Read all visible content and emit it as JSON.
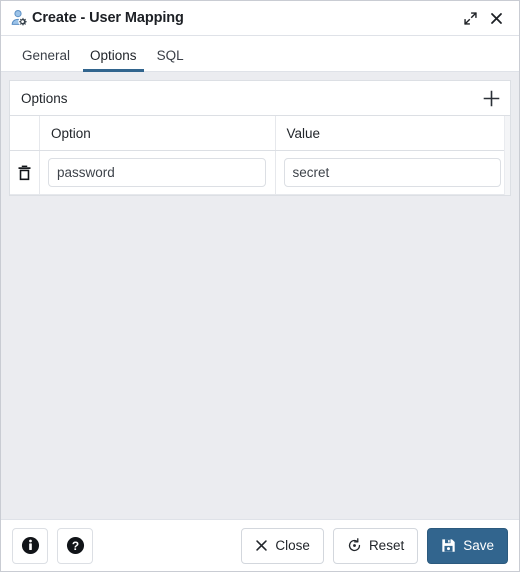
{
  "window": {
    "title": "Create - User Mapping",
    "icon": "user-mapping-icon",
    "maximize_icon": "expand-icon",
    "close_icon": "close-icon"
  },
  "tabs": [
    {
      "label": "General",
      "name": "tab-general",
      "active": false
    },
    {
      "label": "Options",
      "name": "tab-options",
      "active": true
    },
    {
      "label": "SQL",
      "name": "tab-sql",
      "active": false
    }
  ],
  "options_panel": {
    "title": "Options",
    "add_icon": "plus-icon",
    "columns": {
      "delete": "",
      "option": "Option",
      "value": "Value"
    },
    "rows": [
      {
        "delete_icon": "trash-icon",
        "option": "password",
        "option_placeholder": "",
        "value": "secret",
        "value_placeholder": ""
      }
    ]
  },
  "footer": {
    "info_label": "",
    "info_icon": "info-icon",
    "help_label": "",
    "help_icon": "help-icon",
    "close_label": "Close",
    "close_icon": "x-icon",
    "reset_label": "Reset",
    "reset_icon": "reset-icon",
    "save_label": "Save",
    "save_icon": "save-disk-icon"
  },
  "colors": {
    "accent": "#32658e",
    "background": "#ebecf0",
    "panel": "#ffffff",
    "border": "#dcdfe4",
    "text": "#22262b"
  }
}
